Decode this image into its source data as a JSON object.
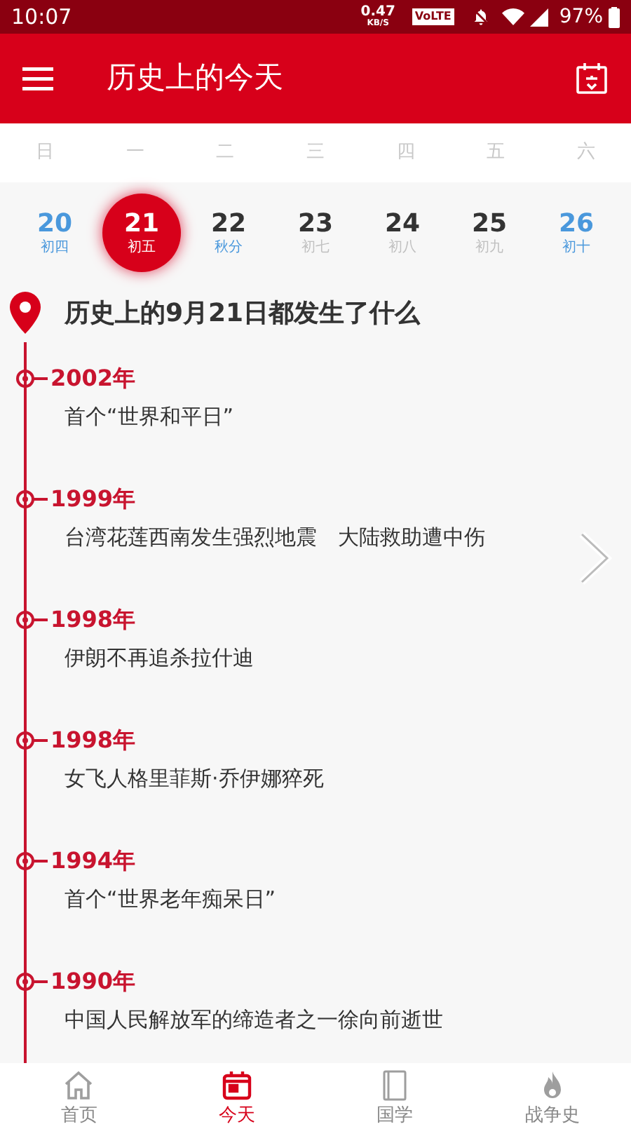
{
  "status_bar": {
    "time": "10:07",
    "speed": "0.47",
    "speed_unit": "KB/S",
    "volte": "VoLTE",
    "battery": "97%"
  },
  "app_bar": {
    "title": "历史上的今天"
  },
  "weekdays": [
    "日",
    "一",
    "二",
    "三",
    "四",
    "五",
    "六"
  ],
  "days": [
    {
      "number": "20",
      "lunar": "初四",
      "selected": false,
      "weekend": true,
      "lunar_highlight": true
    },
    {
      "number": "21",
      "lunar": "初五",
      "selected": true
    },
    {
      "number": "22",
      "lunar": "秋分",
      "selected": false,
      "weekend": false,
      "lunar_highlight": true
    },
    {
      "number": "23",
      "lunar": "初七",
      "selected": false,
      "weekend": false,
      "lunar_highlight": false
    },
    {
      "number": "24",
      "lunar": "初八",
      "selected": false,
      "weekend": false,
      "lunar_highlight": false
    },
    {
      "number": "25",
      "lunar": "初九",
      "selected": false,
      "weekend": false,
      "lunar_highlight": false
    },
    {
      "number": "26",
      "lunar": "初十",
      "selected": false,
      "weekend": true,
      "lunar_highlight": true
    }
  ],
  "heading": "历史上的9月21日都发生了什么",
  "events": [
    {
      "year": "2002年",
      "text": "首个“世界和平日”"
    },
    {
      "year": "1999年",
      "text": "台湾花莲西南发生强烈地震　大陆救助遭中伤"
    },
    {
      "year": "1998年",
      "text": "伊朗不再追杀拉什迪"
    },
    {
      "year": "1998年",
      "text": "女飞人格里菲斯·乔伊娜猝死"
    },
    {
      "year": "1994年",
      "text": "首个“世界老年痴呆日”"
    },
    {
      "year": "1990年",
      "text": "中国人民解放军的缔造者之一徐向前逝世"
    }
  ],
  "bottom_nav": [
    {
      "label": "首页",
      "selected": false
    },
    {
      "label": "今天",
      "selected": true
    },
    {
      "label": "国学",
      "selected": false
    },
    {
      "label": "战争史",
      "selected": false
    }
  ]
}
